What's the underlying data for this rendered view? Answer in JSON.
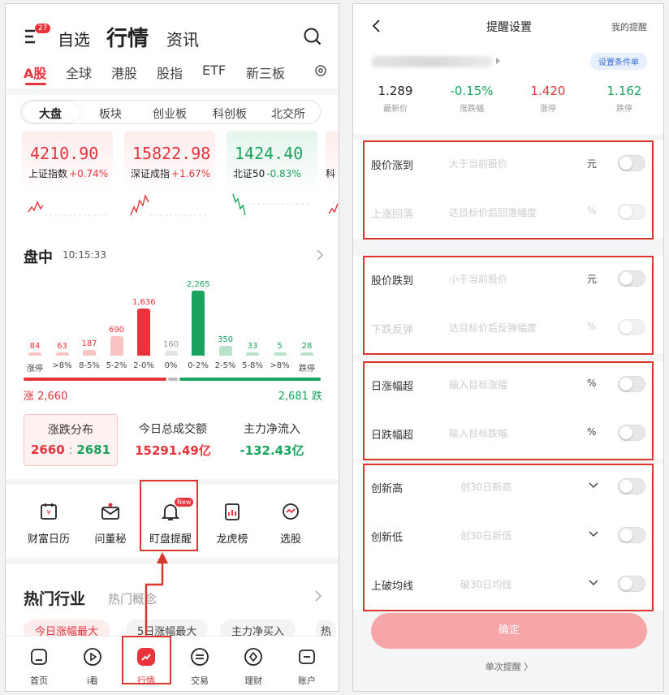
{
  "left": {
    "header": {
      "badge": "27",
      "tabs": [
        "自选",
        "行情",
        "资讯"
      ]
    },
    "markets": [
      "A股",
      "全球",
      "港股",
      "股指",
      "ETF",
      "新三板"
    ],
    "segments": [
      "大盘",
      "板块",
      "创业板",
      "科创板",
      "北交所"
    ],
    "indices": [
      {
        "value": "4210.90",
        "name": "上证指数",
        "change": "+0.74%",
        "trend": "up"
      },
      {
        "value": "15822.98",
        "name": "深证成指",
        "change": "+1.67%",
        "trend": "up"
      },
      {
        "value": "1424.40",
        "name": "北证50",
        "change": "-0.83%",
        "trend": "down"
      },
      {
        "value": "",
        "name": "科",
        "change": "",
        "trend": "up"
      }
    ],
    "intraday": {
      "title": "盘中",
      "time": "10:15:33",
      "buckets": [
        {
          "label": "涨停",
          "count": 84,
          "color": "up"
        },
        {
          "label": ">8%",
          "count": 63,
          "color": "up"
        },
        {
          "label": "8-5%",
          "count": 187,
          "color": "up"
        },
        {
          "label": "5-2%",
          "count": 690,
          "color": "up"
        },
        {
          "label": "2-0%",
          "count": 1636,
          "color": "up"
        },
        {
          "label": "0%",
          "count": 160,
          "color": "flat"
        },
        {
          "label": "0-2%",
          "count": 2265,
          "color": "down"
        },
        {
          "label": "2-5%",
          "count": 350,
          "color": "down"
        },
        {
          "label": "5-8%",
          "count": 33,
          "color": "down"
        },
        {
          "label": ">8%",
          "count": 5,
          "color": "down"
        },
        {
          "label": "跌停",
          "count": 28,
          "color": "down"
        }
      ],
      "bucket_values": [
        "84",
        "63",
        "187",
        "690",
        "1,636",
        "160",
        "2,265",
        "350",
        "33",
        "5",
        "28"
      ],
      "up_text": "涨 2,660",
      "down_text": "2,681 跌"
    },
    "stats": [
      {
        "label": "涨跌分布",
        "value_up": "2660",
        "value_down": "2681"
      },
      {
        "label": "今日总成交额",
        "value": "15291.49亿"
      },
      {
        "label": "主力净流入",
        "value": "-132.43亿"
      }
    ],
    "tools": [
      {
        "label": "财富日历",
        "icon": "calendar-icon"
      },
      {
        "label": "问董秘",
        "icon": "mail-icon"
      },
      {
        "label": "盯盘提醒",
        "icon": "bell-icon",
        "badge": "New"
      },
      {
        "label": "龙虎榜",
        "icon": "chart-board-icon"
      },
      {
        "label": "选股",
        "icon": "target-icon"
      }
    ],
    "hot": {
      "title": "热门行业",
      "subtitle": "热门概念",
      "pills": [
        "今日涨幅最大",
        "5日涨幅最大",
        "主力净买入",
        "热"
      ]
    },
    "nav": [
      "首页",
      "i看",
      "行情",
      "交易",
      "理财",
      "账户"
    ]
  },
  "right": {
    "title": "提醒设置",
    "my_alerts": "我的提醒",
    "condition_btn": "设置条件单",
    "quote": [
      {
        "value": "1.289",
        "label": "最新价",
        "color": "#222222"
      },
      {
        "value": "-0.15%",
        "label": "涨跌幅",
        "color": "#1aa35c"
      },
      {
        "value": "1.420",
        "label": "涨停",
        "color": "#e8333c"
      },
      {
        "value": "1.162",
        "label": "跌停",
        "color": "#1aa35c"
      }
    ],
    "groups": [
      {
        "rows": [
          {
            "label": "股价涨到",
            "placeholder": "大于当前股价",
            "unit": "元",
            "dim": false
          },
          {
            "label": "上涨回落",
            "placeholder": "达目标价后回落幅度",
            "unit": "%",
            "dim": true
          }
        ]
      },
      {
        "rows": [
          {
            "label": "股价跌到",
            "placeholder": "小于当前股价",
            "unit": "元",
            "dim": false
          },
          {
            "label": "下跌反弹",
            "placeholder": "达目标价后反弹幅度",
            "unit": "%",
            "dim": true
          }
        ]
      },
      {
        "rows": [
          {
            "label": "日涨幅超",
            "placeholder": "输入目标涨幅",
            "unit": "%",
            "dim": false
          },
          {
            "label": "日跌幅超",
            "placeholder": "输入目标跌幅",
            "unit": "%",
            "dim": false
          }
        ]
      },
      {
        "rows": [
          {
            "label": "创新高",
            "placeholder": "创30日新高",
            "unit": "",
            "dim": false
          },
          {
            "label": "创新低",
            "placeholder": "创30日新低",
            "unit": "",
            "dim": false
          },
          {
            "label": "上破均线",
            "placeholder": "破30日均线",
            "unit": "",
            "dim": false
          }
        ]
      }
    ],
    "confirm": "确定",
    "single": "单次提醒 〉"
  },
  "colors": {
    "up": "#e8333c",
    "down": "#1aa35c",
    "highlight": "#d9362d"
  }
}
